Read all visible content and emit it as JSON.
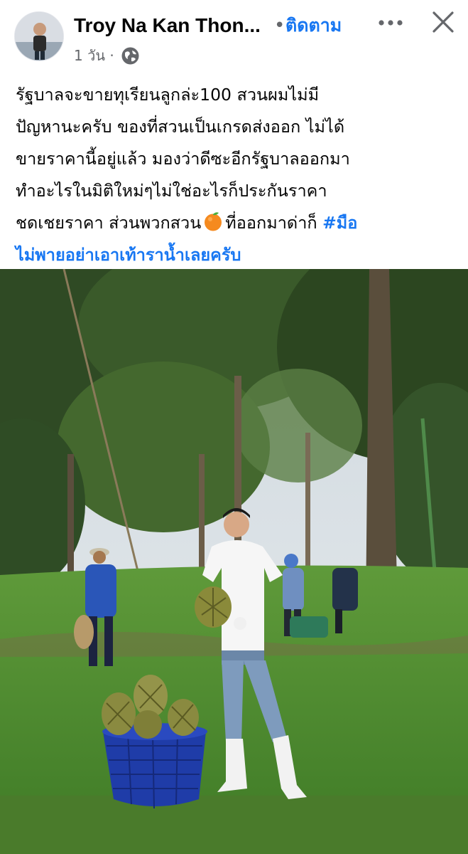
{
  "post": {
    "author": "Troy Na Kan Thon...",
    "separator": "•",
    "follow_label": "ติดตาม",
    "timestamp": "1 วัน ·",
    "text_lines": [
      "รัฐบาลจะขายทุเรียนลูกล่ะ100 สวนผมไม่มี",
      "ปัญหานะครับ ของที่สวนเป็นเกรดส่งออก ไม่ได้",
      "ขายราคานี้อยู่แล้ว มองว่าดีซะอีกรัฐบาลออกมา",
      "ทำอะไรในมิติใหม่ๆไม่ใช่อะไรก็ประกันราคา"
    ],
    "line5_before_emoji": "ชดเชยราคา ส่วนพวกสวน",
    "line5_after_emoji": "ที่ออกมาด่าก็ ",
    "hashtag_line1": "#มือ",
    "hashtag_line2": "ไม่พายอย่าเอาเท้าราน้ำเลยครับ"
  },
  "icons": {
    "more": "more-horizontal-icon",
    "close": "close-icon",
    "globe": "globe-public-icon",
    "emoji": "orange-emoji-icon"
  },
  "colors": {
    "link": "#1877f2",
    "text": "#050505",
    "muted": "#65676b"
  }
}
